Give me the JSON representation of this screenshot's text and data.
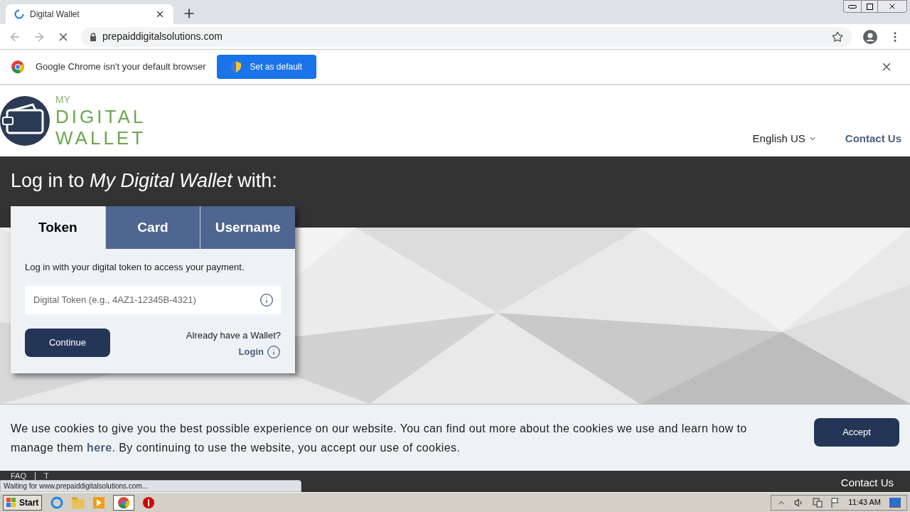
{
  "browser": {
    "tabs": [
      {
        "title": "Digital Wallet",
        "selected": true,
        "loading": true
      }
    ],
    "url": "prepaiddigitalsolutions.com",
    "status": "Waiting for www.prepaiddigitalsolutions.com..."
  },
  "infobar": {
    "message": "Google Chrome isn't your default browser",
    "button": "Set as default"
  },
  "site": {
    "logo": {
      "line1": "MY",
      "line2": "DIGITAL",
      "line3": "WALLET"
    },
    "language": "English US",
    "contact": "Contact Us",
    "heading": "Log in to *My Digital Wallet* with:",
    "login_tabs": [
      {
        "label": "Token",
        "selected": true
      },
      {
        "label": "Card",
        "selected": false
      },
      {
        "label": "Username",
        "selected": false
      }
    ],
    "instruction": "Log in with your digital token to access your payment.",
    "token_placeholder": "Digital Token (e.g., 4AZ1-12345B-4321)",
    "continue": "Continue",
    "already": "Already have a Wallet?",
    "login": "Login",
    "cookie": {
      "before": "We use cookies to give you the best possible experience on our website. You can find out more about the cookies we use and learn how to manage them",
      "link": "here",
      "after": ". By continuing to use the website, you accept our use of cookies.",
      "accept": "Accept"
    },
    "footer": {
      "links": [
        "FAQ",
        "T"
      ],
      "contact": "Contact Us"
    }
  },
  "taskbar": {
    "start": "Start",
    "time": "11:43 AM"
  }
}
